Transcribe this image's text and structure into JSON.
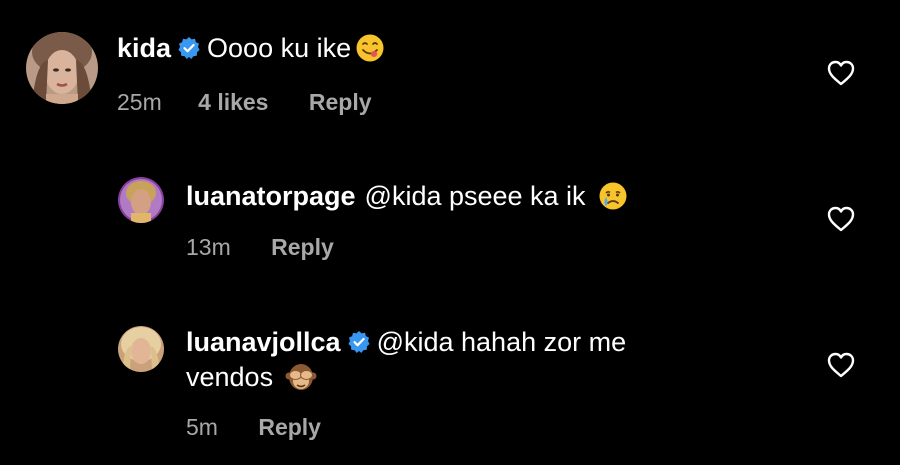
{
  "comments": [
    {
      "username": "kida",
      "verified": true,
      "text": "Oooo ku ike",
      "emoji": "yum-face-emoji",
      "time": "25m",
      "likes": "4 likes",
      "reply": "Reply"
    },
    {
      "username": "luanatorpage",
      "verified": false,
      "text": "@kida pseee ka ik",
      "emoji": "crying-face-emoji",
      "time": "13m",
      "reply": "Reply"
    },
    {
      "username": "luanavjollca",
      "verified": true,
      "text": "@kida hahah zor me",
      "text_line2": "vendos",
      "emoji": "see-no-evil-monkey-emoji",
      "time": "5m",
      "reply": "Reply"
    }
  ],
  "colors": {
    "background": "#000000",
    "text": "#ffffff",
    "meta": "#a8a8a8",
    "verified": "#3897f0"
  }
}
